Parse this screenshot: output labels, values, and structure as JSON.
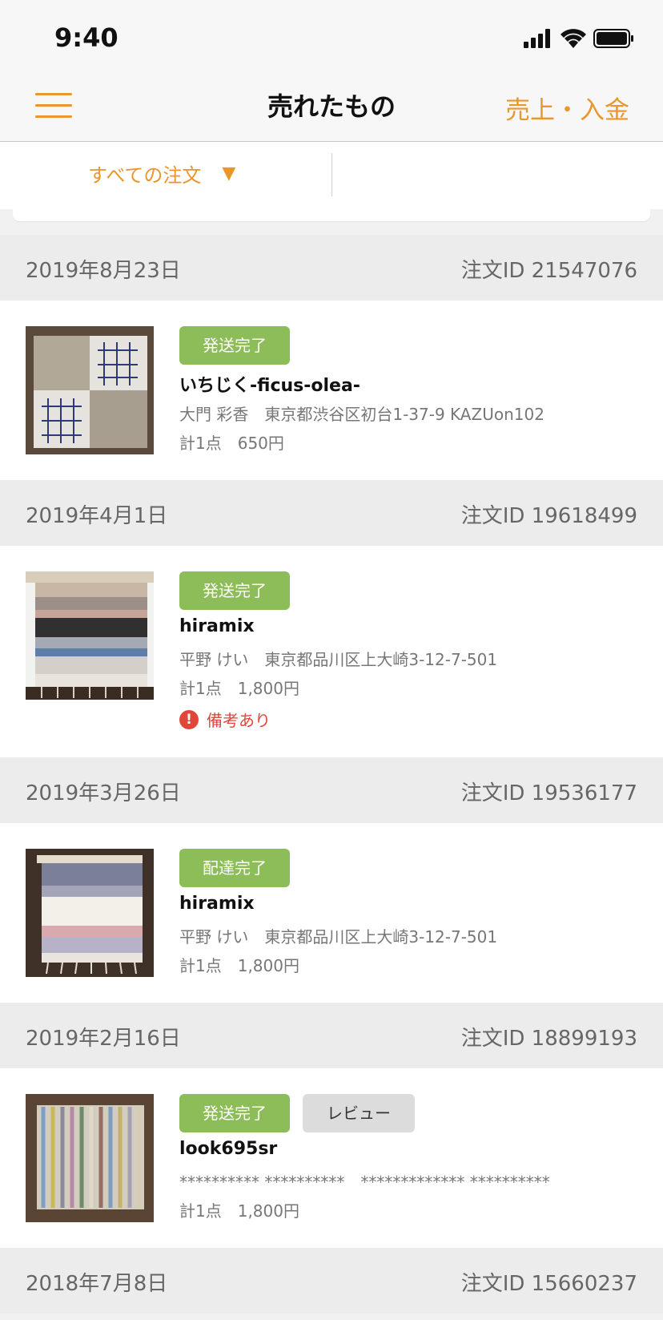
{
  "status_bar": {
    "time": "9:40"
  },
  "nav": {
    "title": "売れたもの",
    "right_link": "売上・入金"
  },
  "filter": {
    "label": "すべての注文",
    "arrow": "▼"
  },
  "orders": [
    {
      "date": "2019年8月23日",
      "order_id": "注文ID 21547076",
      "status": "発送完了",
      "review": "",
      "buyer": "いちじく-ficus-olea-",
      "address": "大門 彩香　東京都渋谷区初台1-37-9 KAZUon102",
      "total": "計1点　650円",
      "remark": ""
    },
    {
      "date": "2019年4月1日",
      "order_id": "注文ID 19618499",
      "status": "発送完了",
      "review": "",
      "buyer": "hiramix",
      "address": "平野 けい　東京都品川区上大崎3-12-7-501",
      "total": "計1点　1,800円",
      "remark": "備考あり"
    },
    {
      "date": "2019年3月26日",
      "order_id": "注文ID 19536177",
      "status": "配達完了",
      "review": "",
      "buyer": "hiramix",
      "address": "平野 けい　東京都品川区上大崎3-12-7-501",
      "total": "計1点　1,800円",
      "remark": ""
    },
    {
      "date": "2019年2月16日",
      "order_id": "注文ID 18899193",
      "status": "発送完了",
      "review": "レビュー",
      "buyer": "look695sr",
      "address": "********** **********　************* **********",
      "total": "計1点　1,800円",
      "remark": ""
    },
    {
      "date": "2018年7月8日",
      "order_id": "注文ID 15660237"
    }
  ],
  "colors": {
    "accent": "#e9962c",
    "status_badge": "#8cbd58",
    "remark": "#e0463a"
  }
}
